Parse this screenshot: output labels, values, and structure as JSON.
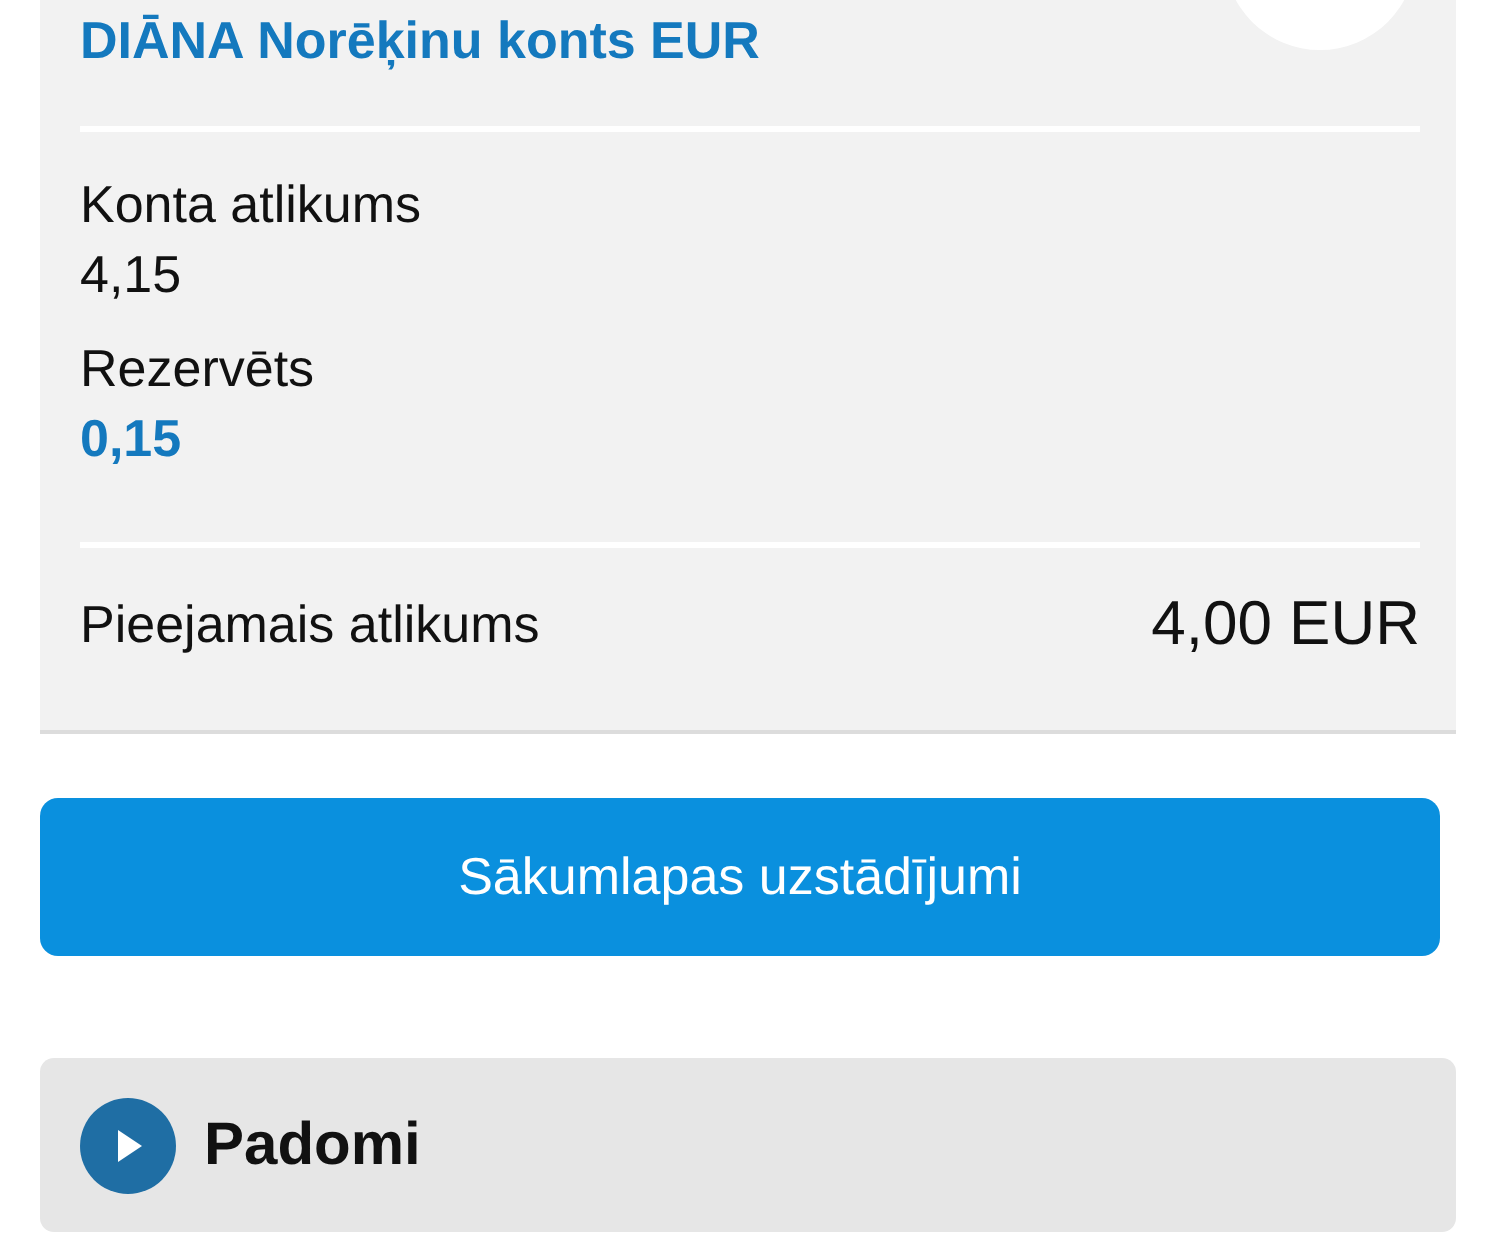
{
  "account": {
    "name": "DIĀNA Norēķinu konts EUR"
  },
  "balances": [
    {
      "label": "Konta atlikums",
      "value": "4,15",
      "kind": "plain"
    },
    {
      "label": "Rezervēts",
      "value": "0,15",
      "kind": "highlight"
    }
  ],
  "available": {
    "label": "Pieejamais atlikums",
    "value": "4,00 EUR"
  },
  "settings_button": {
    "label": "Sākumlapas uzstādījumi"
  },
  "tips": {
    "title": "Padomi",
    "expanded": false
  }
}
